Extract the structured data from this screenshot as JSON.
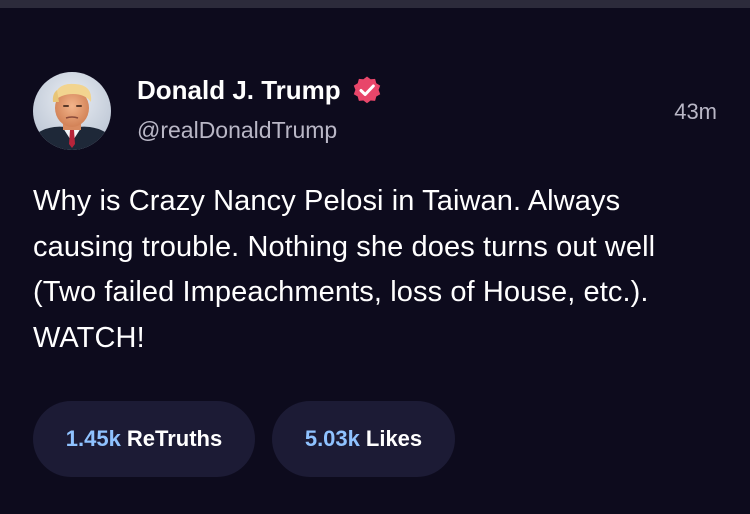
{
  "author": {
    "name": "Donald J. Trump",
    "handle": "@realDonaldTrump",
    "verified": true,
    "avatar_icon": "profile-photo"
  },
  "post": {
    "timestamp": "43m",
    "text": "Why is Crazy Nancy Pelosi in Taiwan. Always causing trouble. Nothing she does turns out well (Two failed Impeachments, loss of House, etc.). WATCH!"
  },
  "stats": {
    "retruths_count": "1.45k",
    "retruths_label": "ReTruths",
    "likes_count": "5.03k",
    "likes_label": "Likes"
  },
  "colors": {
    "background": "#0d0b1d",
    "pill_background": "#1c1b35",
    "accent_count": "#8fc2ff",
    "verified_badge": "#e8466a",
    "muted_text": "#b9b7c6"
  }
}
